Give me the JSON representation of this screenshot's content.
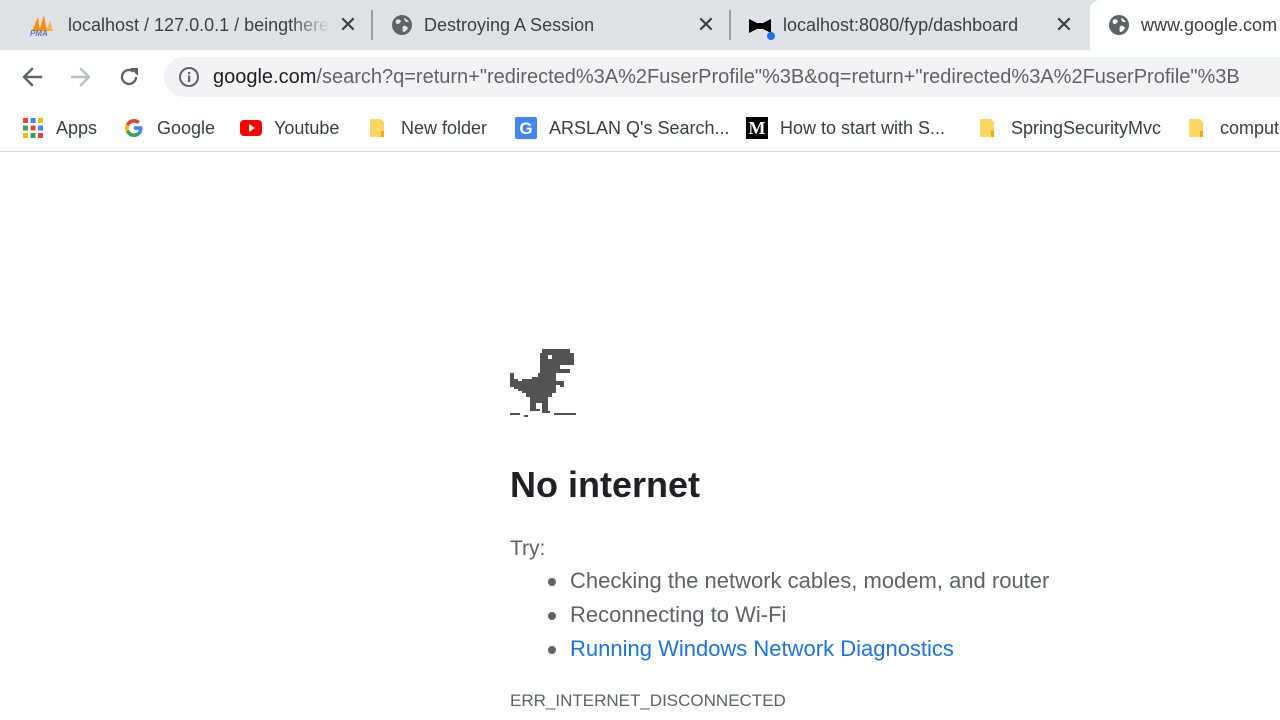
{
  "tabs": [
    {
      "title": "localhost / 127.0.0.1 / beingthere",
      "icon": "phpmyadmin-icon"
    },
    {
      "title": "Destroying A Session",
      "icon": "globe-icon"
    },
    {
      "title": "localhost:8080/fyp/dashboard",
      "icon": "bowtie-icon"
    },
    {
      "title": "www.google.com",
      "icon": "globe-icon"
    }
  ],
  "toolbar": {
    "url_host": "google.com",
    "url_path": "/search?q=return+\"redirected%3A%2FuserProfile\"%3B&oq=return+\"redirected%3A%2FuserProfile\"%3B"
  },
  "bookmarks": [
    {
      "label": "Apps",
      "icon": "apps-grid-icon"
    },
    {
      "label": "Google",
      "icon": "google-icon"
    },
    {
      "label": "Youtube",
      "icon": "youtube-icon"
    },
    {
      "label": "New folder",
      "icon": "folder-icon"
    },
    {
      "label": "ARSLAN Q's Search...",
      "icon": "g-letter-icon"
    },
    {
      "label": "How to start with S...",
      "icon": "medium-icon"
    },
    {
      "label": "SpringSecurityMvc",
      "icon": "folder-icon"
    },
    {
      "label": "computer",
      "icon": "folder-icon"
    }
  ],
  "error_page": {
    "heading": "No internet",
    "try_label": "Try:",
    "suggestions": [
      "Checking the network cables, modem, and router",
      "Reconnecting to Wi-Fi"
    ],
    "diagnostics_link": "Running Windows Network Diagnostics",
    "error_code": "ERR_INTERNET_DISCONNECTED"
  },
  "colors": {
    "tab_strip": "#dee1e6",
    "link": "#1a73e8",
    "text_secondary": "#5f6368"
  }
}
